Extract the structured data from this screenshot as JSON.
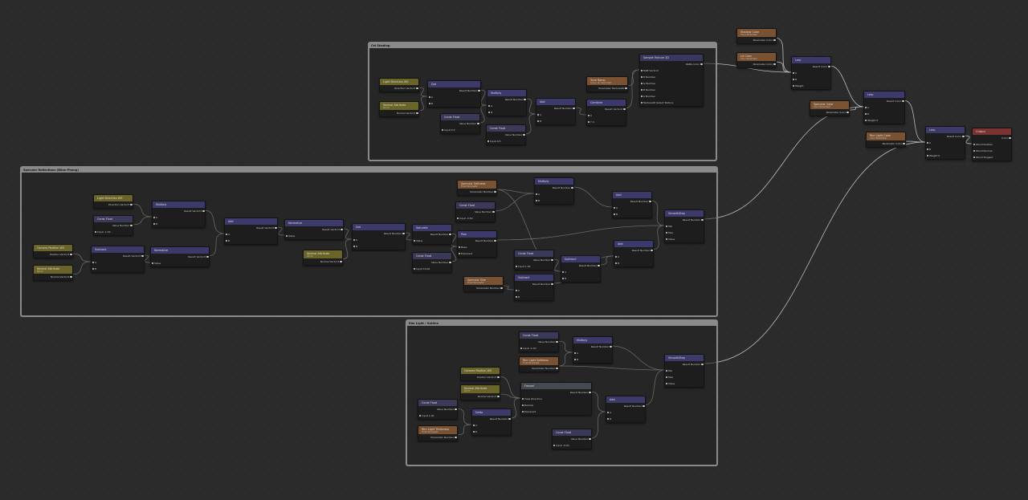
{
  "groups": [
    {
      "title": "Cel Shading"
    },
    {
      "title": "Specular Reflections (Blinn-Phong)"
    },
    {
      "title": "Rim Light / Outline"
    }
  ],
  "nodes": [
    {
      "id": "n1",
      "type": "h-in",
      "title": "Light Direction WS",
      "rows": [
        "Direction  Vector3"
      ]
    },
    {
      "id": "n2",
      "type": "h-in",
      "title": "Normal Attribute",
      "sub": "World",
      "rows": [
        "Normal  Vector3"
      ]
    },
    {
      "id": "n3",
      "type": "h-op",
      "title": "Dot",
      "rows": [
        "Result  Number",
        "A",
        "B"
      ]
    },
    {
      "id": "n4",
      "type": "h-const",
      "title": "Const Float",
      "rows": [
        "Value  Number",
        "Input  0.5"
      ]
    },
    {
      "id": "n5",
      "type": "h-op",
      "title": "Multiply",
      "rows": [
        "Result  Number",
        "A",
        "B"
      ]
    },
    {
      "id": "n6",
      "type": "h-const",
      "title": "Const Float",
      "rows": [
        "Value  Number",
        "Input  0.5"
      ]
    },
    {
      "id": "n7",
      "type": "h-op",
      "title": "Add",
      "rows": [
        "Result  Number",
        "A",
        "B"
      ]
    },
    {
      "id": "n8",
      "type": "h-param",
      "title": "Tone Ramp",
      "sub": "Scene (2) Texture2D",
      "rows": [
        "Parameter  Texture2D"
      ]
    },
    {
      "id": "n9",
      "type": "h-op",
      "title": "Combine",
      "rows": [
        "Result  Vector2",
        "X",
        "Y  0"
      ]
    },
    {
      "id": "n10",
      "type": "h-tex",
      "title": "Sample Texture 2D",
      "rows": [
        "RGBA  Color",
        "RGB  Vector3",
        "R  Number",
        "G  Number",
        "B  Number",
        "A  Number",
        "Texture2D   Select Texture"
      ]
    },
    {
      "id": "n11",
      "type": "h-param",
      "title": "Shadow Color",
      "sub": "Color Parameter",
      "rows": [
        "Parameter  Color"
      ]
    },
    {
      "id": "n12",
      "type": "h-param",
      "title": "Lit Color",
      "sub": "Color Parameter",
      "rows": [
        "Parameter  Color"
      ]
    },
    {
      "id": "n13",
      "type": "h-op",
      "title": "Lerp",
      "rows": [
        "Result  Color",
        "A",
        "B",
        "Weight"
      ]
    },
    {
      "id": "n14",
      "type": "h-param",
      "title": "Specular Color",
      "sub": "Color Parameter",
      "rows": [
        "Parameter  Color"
      ]
    },
    {
      "id": "n15",
      "type": "h-op",
      "title": "Lerp",
      "rows": [
        "Result  Color",
        "A",
        "B",
        "Weight  0"
      ]
    },
    {
      "id": "n16",
      "type": "h-param",
      "title": "Rim Light Color",
      "sub": "Color Parameter",
      "rows": [
        "Parameter  Color"
      ]
    },
    {
      "id": "n17",
      "type": "h-op",
      "title": "Lerp",
      "rows": [
        "Result  Color",
        "A",
        "B",
        "Weight  0"
      ]
    },
    {
      "id": "n18",
      "type": "h-out",
      "title": "Output",
      "rows": [
        "Color",
        "World Position",
        "World Normal",
        "World Tangent"
      ]
    },
    {
      "id": "s1",
      "type": "h-in",
      "title": "Light Direction WS",
      "rows": [
        "Direction  Vector3"
      ]
    },
    {
      "id": "s2",
      "type": "h-const",
      "title": "Const Float",
      "rows": [
        "Value  Number",
        "Input  -1.00"
      ]
    },
    {
      "id": "s3",
      "type": "h-op",
      "title": "Multiply",
      "rows": [
        "Result  Vector3",
        "A",
        "B"
      ]
    },
    {
      "id": "s4",
      "type": "h-in",
      "title": "Camera Position WS",
      "rows": [
        "Position  Vector3"
      ]
    },
    {
      "id": "s5",
      "type": "h-in",
      "title": "Normal Attribute",
      "sub": "World",
      "rows": [
        "Normal  Vector3"
      ]
    },
    {
      "id": "s6",
      "type": "h-op",
      "title": "Subtract",
      "rows": [
        "Result  Vector3",
        "A",
        "B"
      ]
    },
    {
      "id": "s7",
      "type": "h-op",
      "title": "Normalize",
      "rows": [
        "Result  Vector3",
        "Value"
      ]
    },
    {
      "id": "s8",
      "type": "h-op",
      "title": "Add",
      "rows": [
        "Result  Vector3",
        "A",
        "B"
      ]
    },
    {
      "id": "s9",
      "type": "h-op",
      "title": "Normalize",
      "rows": [
        "Result  Vector3",
        "Value"
      ]
    },
    {
      "id": "s10",
      "type": "h-in",
      "title": "Normal Attribute",
      "sub": "World",
      "rows": [
        "Normal  Vector3"
      ]
    },
    {
      "id": "s11",
      "type": "h-op",
      "title": "Dot",
      "rows": [
        "Result  Number",
        "A",
        "B"
      ]
    },
    {
      "id": "s12",
      "type": "h-op",
      "title": "Saturate",
      "rows": [
        "Result  Number",
        "Value"
      ]
    },
    {
      "id": "s13",
      "type": "h-const",
      "title": "Const Float",
      "rows": [
        "Value  Number",
        "Input  10.00"
      ]
    },
    {
      "id": "s14",
      "type": "h-param",
      "title": "Specular Softness",
      "sub": "Float Parameter",
      "rows": [
        "Parameter  Number"
      ]
    },
    {
      "id": "s15",
      "type": "h-const",
      "title": "Const Float",
      "rows": [
        "Value  Number",
        "Input  -0.50"
      ]
    },
    {
      "id": "s16",
      "type": "h-op",
      "title": "Pow",
      "rows": [
        "Result  Number",
        "Base",
        "Exponent"
      ]
    },
    {
      "id": "s17",
      "type": "h-param",
      "title": "Specular Size",
      "sub": "Float Parameter",
      "rows": [
        "Parameter  Number"
      ]
    },
    {
      "id": "s18",
      "type": "h-op",
      "title": "Multiply",
      "rows": [
        "Result  Number",
        "A",
        "B"
      ]
    },
    {
      "id": "s19",
      "type": "h-const",
      "title": "Const Float",
      "rows": [
        "Value  Number",
        "Input  1.00"
      ]
    },
    {
      "id": "s20",
      "type": "h-op",
      "title": "Subtract",
      "rows": [
        "Result  Number",
        "A",
        "B"
      ]
    },
    {
      "id": "s21",
      "type": "h-op",
      "title": "Subtract",
      "rows": [
        "Result  Number",
        "A",
        "B"
      ]
    },
    {
      "id": "s22",
      "type": "h-op",
      "title": "Add",
      "rows": [
        "Result  Number",
        "A",
        "B"
      ]
    },
    {
      "id": "s23",
      "type": "h-op",
      "title": "Add",
      "rows": [
        "Result  Number",
        "A",
        "B"
      ]
    },
    {
      "id": "s24",
      "type": "h-op",
      "title": "SmoothStep",
      "rows": [
        "Result  Number",
        "Min",
        "Max",
        "Value"
      ]
    },
    {
      "id": "r1",
      "type": "h-const",
      "title": "Const Float",
      "rows": [
        "Value  Number",
        "Input  -1.00"
      ]
    },
    {
      "id": "r2",
      "type": "h-param",
      "title": "Rim Light Softness",
      "sub": "Float Parameter",
      "rows": [
        "Parameter  Number"
      ]
    },
    {
      "id": "r3",
      "type": "h-op",
      "title": "Multiply",
      "rows": [
        "Result  Number",
        "A",
        "B"
      ]
    },
    {
      "id": "r4",
      "type": "h-in",
      "title": "Camera Position WS",
      "rows": [
        "Position  Vector3"
      ]
    },
    {
      "id": "r5",
      "type": "h-in",
      "title": "Normal Attribute",
      "sub": "World",
      "rows": [
        "Normal  Vector3"
      ]
    },
    {
      "id": "r6",
      "type": "h-fres",
      "title": "Fresnel",
      "rows": [
        "Result  Number",
        "View Direction",
        "Normal",
        "Exponent"
      ]
    },
    {
      "id": "r7",
      "type": "h-const",
      "title": "Const Float",
      "rows": [
        "Value  Number",
        "Input  1.00"
      ]
    },
    {
      "id": "r8",
      "type": "h-param",
      "title": "Rim Light Thickness",
      "sub": "Float Parameter",
      "rows": [
        "Parameter  Number"
      ]
    },
    {
      "id": "r9",
      "type": "h-op",
      "title": "Delta",
      "rows": [
        "Result  Number",
        "A",
        "B"
      ]
    },
    {
      "id": "r10",
      "type": "h-op",
      "title": "Add",
      "rows": [
        "Result  Number",
        "A",
        "B"
      ]
    },
    {
      "id": "r11",
      "type": "h-const",
      "title": "Const Float",
      "rows": [
        "Value  Number",
        "Input  -0.00"
      ]
    },
    {
      "id": "r12",
      "type": "h-op",
      "title": "SmoothStep",
      "rows": [
        "Result  Number",
        "Min",
        "Max",
        "Value"
      ]
    }
  ]
}
